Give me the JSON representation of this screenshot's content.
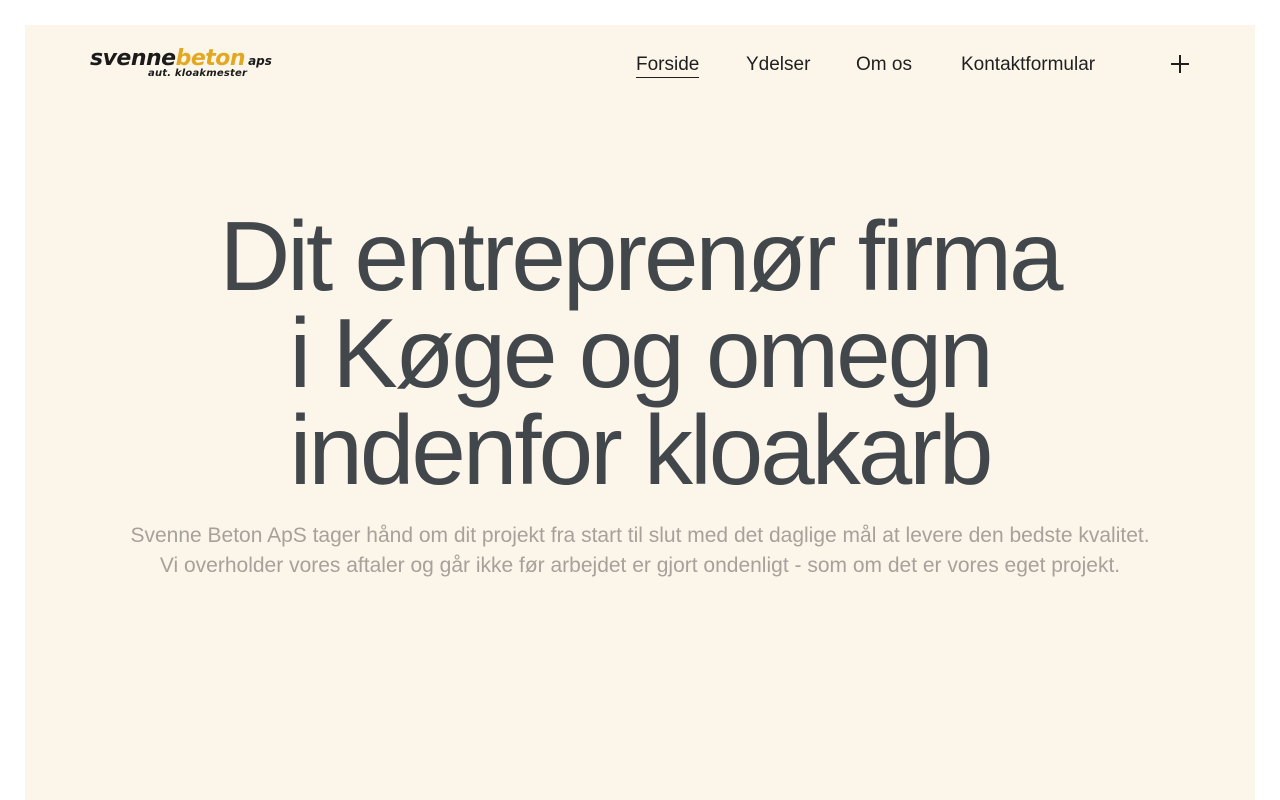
{
  "logo": {
    "part1": "svenne",
    "part2": "beton",
    "suffix": "aps",
    "tagline": "aut. kloakmester",
    "brand_color": "#e3a821",
    "dark_color": "#1b1b1b"
  },
  "nav": {
    "items": [
      {
        "label": "Forside",
        "active": true
      },
      {
        "label": "Ydelser",
        "active": false
      },
      {
        "label": "Om os",
        "active": false
      },
      {
        "label": "Kontaktformular",
        "active": false
      }
    ],
    "menu_icon": "plus-icon"
  },
  "hero": {
    "title_lines": [
      "Dit entreprenør firma",
      "i Køge og omegn",
      "indenfor kloakarb"
    ],
    "description_lines": [
      "Svenne Beton ApS tager hånd om dit projekt fra start til slut med det daglige mål at levere den bedste kvalitet.",
      "Vi overholder vores aftaler og går ikke før arbejdet er gjort ondenligt - som om det er vores eget projekt."
    ]
  },
  "colors": {
    "page_background": "#ffffff",
    "panel_background": "#fcf5ea",
    "heading": "#42474b",
    "body_text": "#a6a29b"
  }
}
